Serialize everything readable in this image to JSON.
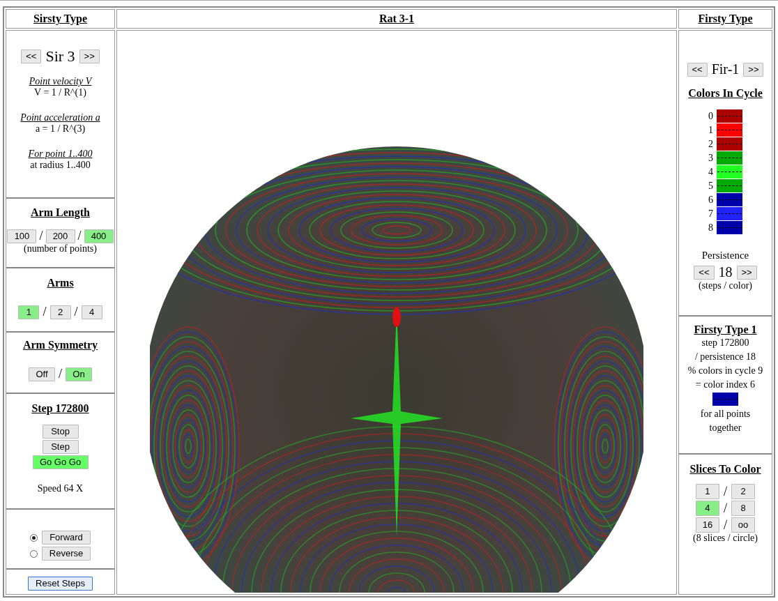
{
  "left_panel": {
    "title": "Sirsty Type",
    "type_selector": {
      "prev": "<<",
      "value": "Sir 3",
      "next": ">>"
    },
    "formulas": [
      {
        "label": "Point velocity V",
        "value": "V = 1 / R^(1)"
      },
      {
        "label": "Point acceleration a",
        "value": "a = 1 / R^(3)"
      },
      {
        "label": "For point 1..400",
        "value": "at radius 1..400"
      }
    ],
    "arm_length": {
      "title": "Arm Length",
      "separator": "/",
      "options": [
        {
          "label": "100",
          "selected": false
        },
        {
          "label": "200",
          "selected": false
        },
        {
          "label": "400",
          "selected": true
        }
      ],
      "note": "(number of points)"
    },
    "arms": {
      "title": "Arms",
      "separator": "/",
      "options": [
        {
          "label": "1",
          "selected": true
        },
        {
          "label": "2",
          "selected": false
        },
        {
          "label": "4",
          "selected": false
        }
      ]
    },
    "arm_symmetry": {
      "title": "Arm Symmetry",
      "separator": "/",
      "options": [
        {
          "label": "Off",
          "selected": false
        },
        {
          "label": "On",
          "selected": true
        }
      ]
    },
    "step": {
      "title": "Step 172800",
      "buttons": [
        {
          "label": "Stop",
          "selected": false
        },
        {
          "label": "Step",
          "selected": false
        },
        {
          "label": "Go Go Go",
          "selected": true
        }
      ],
      "speed": "Speed 64 X"
    },
    "direction": [
      {
        "label": "Forward",
        "selected": true
      },
      {
        "label": "Reverse",
        "selected": false
      }
    ],
    "reset_button": "Reset Steps"
  },
  "center_panel": {
    "title": "Rat 3-1"
  },
  "right_panel": {
    "title": "Firsty Type",
    "type_selector": {
      "prev": "<<",
      "value": "Fir-1",
      "next": ">>"
    },
    "colors_title": "Colors In Cycle",
    "colors": [
      {
        "index": "0",
        "color": "#aa0000"
      },
      {
        "index": "1",
        "color": "#ff0000"
      },
      {
        "index": "2",
        "color": "#aa0000"
      },
      {
        "index": "3",
        "color": "#00aa00"
      },
      {
        "index": "4",
        "color": "#22ff22"
      },
      {
        "index": "5",
        "color": "#00aa00"
      },
      {
        "index": "6",
        "color": "#0000aa"
      },
      {
        "index": "7",
        "color": "#2222ff"
      },
      {
        "index": "8",
        "color": "#0000aa"
      }
    ],
    "persistence": {
      "label": "Persistence",
      "prev": "<<",
      "value": "18",
      "next": ">>",
      "note": "(steps / color)"
    },
    "result": {
      "title": "Firsty Type 1",
      "lines": [
        "step 172800",
        "/ persistence 18",
        "% colors in cycle 9",
        "= color index 6"
      ],
      "swatch": {
        "color": "#0000aa"
      },
      "footer": "for all points together"
    },
    "slices": {
      "title": "Slices To Color",
      "separator": "/",
      "options": [
        {
          "label": "1",
          "selected": false
        },
        {
          "label": "2",
          "selected": false
        },
        {
          "label": "4",
          "selected": true
        },
        {
          "label": "8",
          "selected": false
        },
        {
          "label": "16",
          "selected": false
        },
        {
          "label": "oo",
          "selected": false
        }
      ],
      "note": "(8 slices / circle)"
    }
  }
}
